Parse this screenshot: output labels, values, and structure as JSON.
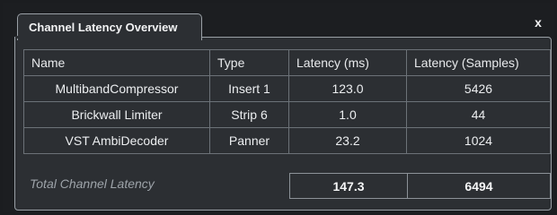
{
  "panel": {
    "tab_title": "Channel Latency Overview",
    "close_label": "x"
  },
  "table": {
    "columns": [
      "Name",
      "Type",
      "Latency (ms)",
      "Latency (Samples)"
    ],
    "rows": [
      {
        "name": "MultibandCompressor",
        "type": "Insert 1",
        "latency_ms": "123.0",
        "latency_samples": "5426"
      },
      {
        "name": "Brickwall Limiter",
        "type": "Strip 6",
        "latency_ms": "1.0",
        "latency_samples": "44"
      },
      {
        "name": "VST AmbiDecoder",
        "type": "Panner",
        "latency_ms": "23.2",
        "latency_samples": "1024"
      }
    ]
  },
  "totals": {
    "label": "Total Channel Latency",
    "latency_ms": "147.3",
    "latency_samples": "6494"
  }
}
